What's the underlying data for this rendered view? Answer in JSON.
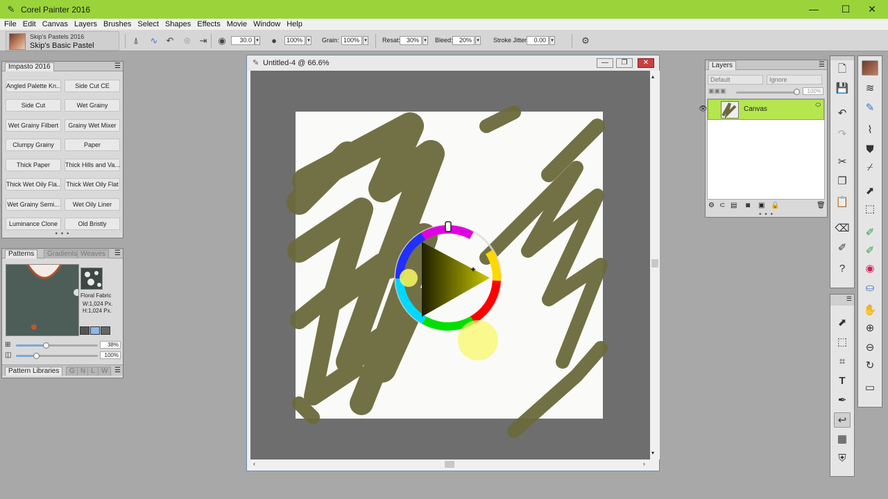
{
  "window": {
    "title": "Corel Painter 2016"
  },
  "menu": [
    "File",
    "Edit",
    "Canvas",
    "Layers",
    "Brushes",
    "Select",
    "Shapes",
    "Effects",
    "Movie",
    "Window",
    "Help"
  ],
  "property_bar": {
    "brush_category": "Skip's Pastels 2016",
    "brush_variant": "Skip's Basic Pastel",
    "size": "30.0",
    "opacity": "100%",
    "grain_label": "Grain:",
    "grain": "100%",
    "resat_label": "Resat:",
    "resat": "30%",
    "bleed_label": "Bleed:",
    "bleed": "20%",
    "jitter_label": "Stroke Jitter:",
    "jitter": "0.00"
  },
  "impasto_panel": {
    "tab": "Impasto 2016",
    "presets": [
      "Angled Palette Kn...",
      "Side Cut CE",
      "Side Cut",
      "Wet Grainy",
      "Wet Grainy Filbert",
      "Grainy Wet Mixer",
      "Clumpy Grainy",
      "Paper",
      "Thick Paper",
      "Thick Hills and Va...",
      "Thick Wet Oily Fla...",
      "Thick Wet Oily Flat",
      "Wet Grainy Semi...",
      "Wet Oily Liner",
      "Luminance Clone",
      "Old Bristly"
    ],
    "dots": "• • •"
  },
  "patterns_panel": {
    "tabs": [
      "Patterns",
      "Gradients",
      "Weaves"
    ],
    "pattern_name": "Floral Fabric",
    "width": "W:1,024 Px.",
    "height": "H:1,024 Px.",
    "scale": "38%",
    "opacity": "100%",
    "libraries_label": "Pattern Libraries",
    "lib_tabs": [
      "G",
      "N",
      "L",
      "W"
    ]
  },
  "document": {
    "title": "Untitled-4 @ 66.6%"
  },
  "layers_panel": {
    "tab": "Layers",
    "composite_method": "Default",
    "depth": "Ignore",
    "opacity": "100%",
    "layer_name": "Canvas",
    "dots": "• • •"
  },
  "colors": {
    "accent": "#9ad43a",
    "paint": "#6b6a3c",
    "selection": "#b5e64e"
  }
}
